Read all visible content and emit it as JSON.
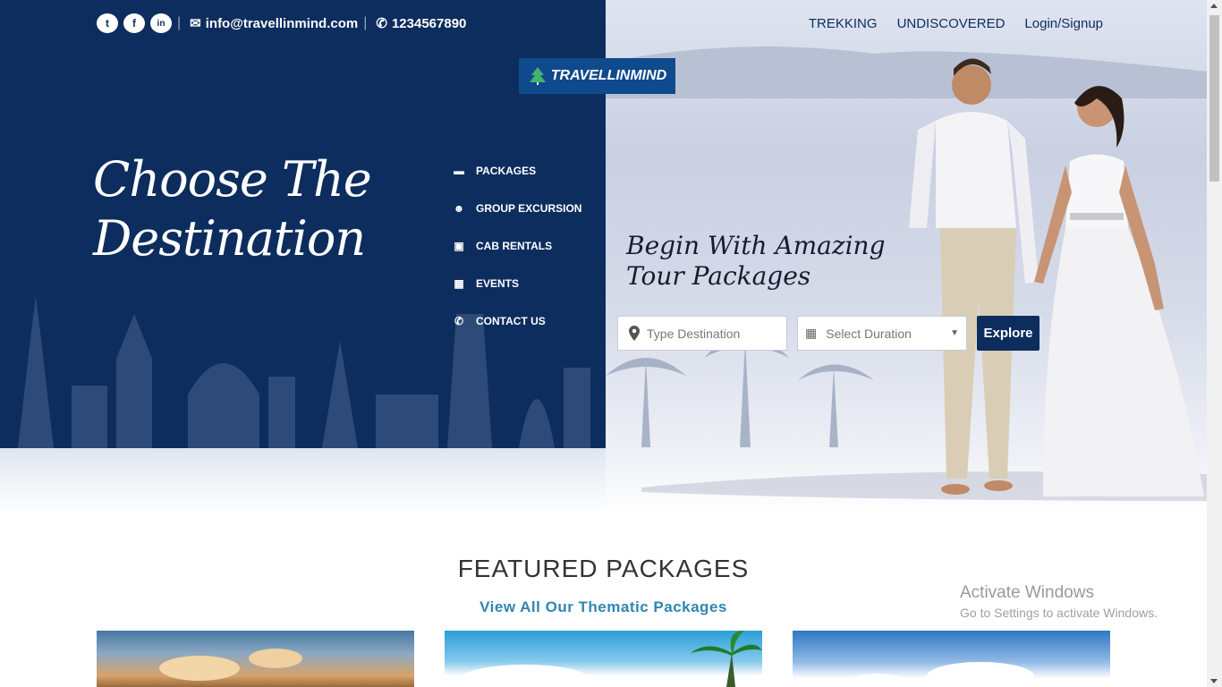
{
  "topbar": {
    "social": [
      {
        "icon": "twitter-icon",
        "glyph": "t"
      },
      {
        "icon": "facebook-icon",
        "glyph": "f"
      },
      {
        "icon": "linkedin-icon",
        "glyph": "in"
      }
    ],
    "email": "info@travellinmind.com",
    "phone": "1234567890",
    "nav": [
      "TREKKING",
      "UNDISCOVERED",
      "Login/Signup"
    ]
  },
  "logo": {
    "text": "TRAVELLINMIND"
  },
  "hero": {
    "headline_line1": "Choose The",
    "headline_line2": "Destination",
    "tagline_line1": "Begin With Amazing",
    "tagline_line2": "Tour Packages"
  },
  "sidenav": [
    {
      "label": "PACKAGES",
      "icon": "briefcase-icon",
      "glyph": "▬"
    },
    {
      "label": "GROUP EXCURSION",
      "icon": "users-icon",
      "glyph": "☻"
    },
    {
      "label": "CAB RENTALS",
      "icon": "car-icon",
      "glyph": "▣"
    },
    {
      "label": "EVENTS",
      "icon": "calendar-icon",
      "glyph": "▦"
    },
    {
      "label": "CONTACT US",
      "icon": "phone-icon",
      "glyph": "✆"
    }
  ],
  "search": {
    "destination_placeholder": "Type Destination",
    "duration_placeholder": "Select Duration",
    "button_label": "Explore"
  },
  "featured": {
    "title": "FEATURED PACKAGES",
    "link": "View All Our Thematic Packages"
  },
  "watermark": {
    "title": "Activate Windows",
    "subtitle": "Go to Settings to activate Windows."
  },
  "colors": {
    "navy": "#0d2d5e",
    "link_blue": "#2f86b0",
    "logo_blue": "#0e4a8c"
  }
}
